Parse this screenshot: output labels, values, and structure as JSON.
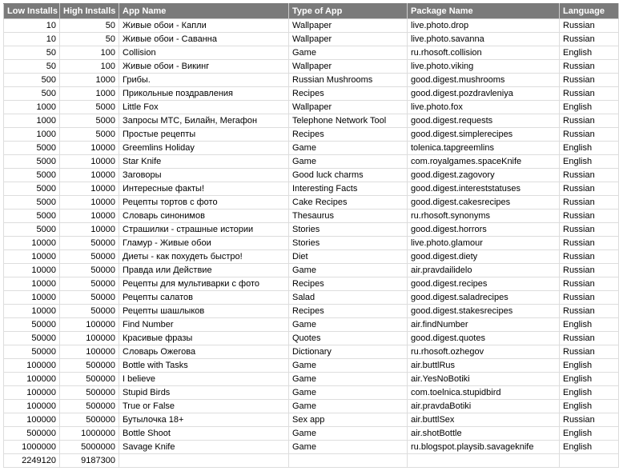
{
  "headers": {
    "low": "Low Installs",
    "high": "High Installs",
    "name": "App Name",
    "type": "Type of App",
    "pkg": "Package Name",
    "lang": "Language"
  },
  "rows": [
    {
      "low": "10",
      "high": "50",
      "name": "Живые обои - Капли",
      "type": "Wallpaper",
      "pkg": "live.photo.drop",
      "lang": "Russian"
    },
    {
      "low": "10",
      "high": "50",
      "name": "Живые обои - Саванна",
      "type": "Wallpaper",
      "pkg": "live.photo.savanna",
      "lang": "Russian"
    },
    {
      "low": "50",
      "high": "100",
      "name": "Collision",
      "type": "Game",
      "pkg": "ru.rhosoft.collision",
      "lang": "English"
    },
    {
      "low": "50",
      "high": "100",
      "name": "Живые обои - Викинг",
      "type": "Wallpaper",
      "pkg": "live.photo.viking",
      "lang": "Russian"
    },
    {
      "low": "500",
      "high": "1000",
      "name": "Грибы.",
      "type": "Russian Mushrooms",
      "pkg": "good.digest.mushrooms",
      "lang": "Russian"
    },
    {
      "low": "500",
      "high": "1000",
      "name": "Прикольные поздравления",
      "type": "Recipes",
      "pkg": "good.digest.pozdravleniya",
      "lang": "Russian"
    },
    {
      "low": "1000",
      "high": "5000",
      "name": "Little Fox",
      "type": "Wallpaper",
      "pkg": "live.photo.fox",
      "lang": "English"
    },
    {
      "low": "1000",
      "high": "5000",
      "name": "Запросы МТС, Билайн, Мегафон",
      "type": "Telephone Network Tool",
      "pkg": "good.digest.requests",
      "lang": "Russian"
    },
    {
      "low": "1000",
      "high": "5000",
      "name": "Простые рецепты",
      "type": "Recipes",
      "pkg": "good.digest.simplerecipes",
      "lang": "Russian"
    },
    {
      "low": "5000",
      "high": "10000",
      "name": "Greemlins Holiday",
      "type": "Game",
      "pkg": "tolenica.tapgreemlins",
      "lang": "English"
    },
    {
      "low": "5000",
      "high": "10000",
      "name": "Star Knife",
      "type": "Game",
      "pkg": "com.royalgames.spaceKnife",
      "lang": "English"
    },
    {
      "low": "5000",
      "high": "10000",
      "name": "Заговоры",
      "type": "Good luck charms",
      "pkg": "good.digest.zagovory",
      "lang": "Russian"
    },
    {
      "low": "5000",
      "high": "10000",
      "name": "Интересные факты!",
      "type": "Interesting Facts",
      "pkg": "good.digest.intereststatuses",
      "lang": "Russian"
    },
    {
      "low": "5000",
      "high": "10000",
      "name": "Рецепты тортов с фото",
      "type": "Cake Recipes",
      "pkg": "good.digest.cakesrecipes",
      "lang": "Russian"
    },
    {
      "low": "5000",
      "high": "10000",
      "name": "Словарь синонимов",
      "type": "Thesaurus",
      "pkg": "ru.rhosoft.synonyms",
      "lang": "Russian"
    },
    {
      "low": "5000",
      "high": "10000",
      "name": "Страшилки - страшные истории",
      "type": "Stories",
      "pkg": "good.digest.horrors",
      "lang": "Russian"
    },
    {
      "low": "10000",
      "high": "50000",
      "name": "Гламур - Живые обои",
      "type": "Stories",
      "pkg": "live.photo.glamour",
      "lang": "Russian"
    },
    {
      "low": "10000",
      "high": "50000",
      "name": "Диеты - как похудеть быстро!",
      "type": "Diet",
      "pkg": "good.digest.diety",
      "lang": "Russian"
    },
    {
      "low": "10000",
      "high": "50000",
      "name": "Правда или Действие",
      "type": "Game",
      "pkg": "air.pravdailidelo",
      "lang": "Russian"
    },
    {
      "low": "10000",
      "high": "50000",
      "name": "Рецепты для мультиварки с фото",
      "type": "Recipes",
      "pkg": "good.digest.recipes",
      "lang": "Russian"
    },
    {
      "low": "10000",
      "high": "50000",
      "name": "Рецепты салатов",
      "type": "Salad",
      "pkg": "good.digest.saladrecipes",
      "lang": "Russian"
    },
    {
      "low": "10000",
      "high": "50000",
      "name": "Рецепты шашлыков",
      "type": "Recipes",
      "pkg": "good.digest.stakesrecipes",
      "lang": "Russian"
    },
    {
      "low": "50000",
      "high": "100000",
      "name": "Find Number",
      "type": "Game",
      "pkg": "air.findNumber",
      "lang": "English"
    },
    {
      "low": "50000",
      "high": "100000",
      "name": "Красивые фразы",
      "type": "Quotes",
      "pkg": "good.digest.quotes",
      "lang": "Russian"
    },
    {
      "low": "50000",
      "high": "100000",
      "name": "Словарь Ожегова",
      "type": "Dictionary",
      "pkg": "ru.rhosoft.ozhegov",
      "lang": "Russian"
    },
    {
      "low": "100000",
      "high": "500000",
      "name": "Bottle with Tasks",
      "type": "Game",
      "pkg": "air.buttlRus",
      "lang": "English"
    },
    {
      "low": "100000",
      "high": "500000",
      "name": "I believe",
      "type": "Game",
      "pkg": "air.YesNoBotiki",
      "lang": "English"
    },
    {
      "low": "100000",
      "high": "500000",
      "name": "Stupid Birds",
      "type": "Game",
      "pkg": "com.toelnica.stupidbird",
      "lang": "English"
    },
    {
      "low": "100000",
      "high": "500000",
      "name": "True or False",
      "type": "Game",
      "pkg": "air.pravdaBotiki",
      "lang": "English"
    },
    {
      "low": "100000",
      "high": "500000",
      "name": "Бутылочка 18+",
      "type": "Sex app",
      "pkg": "air.buttlSex",
      "lang": "Russian"
    },
    {
      "low": "500000",
      "high": "1000000",
      "name": "Bottle Shoot",
      "type": "Game",
      "pkg": "air.shotBottle",
      "lang": "English"
    },
    {
      "low": "1000000",
      "high": "5000000",
      "name": "Savage Knife",
      "type": "Game",
      "pkg": "ru.blogspot.playsib.savageknife",
      "lang": "English"
    },
    {
      "low": "2249120",
      "high": "9187300",
      "name": "",
      "type": "",
      "pkg": "",
      "lang": ""
    }
  ]
}
